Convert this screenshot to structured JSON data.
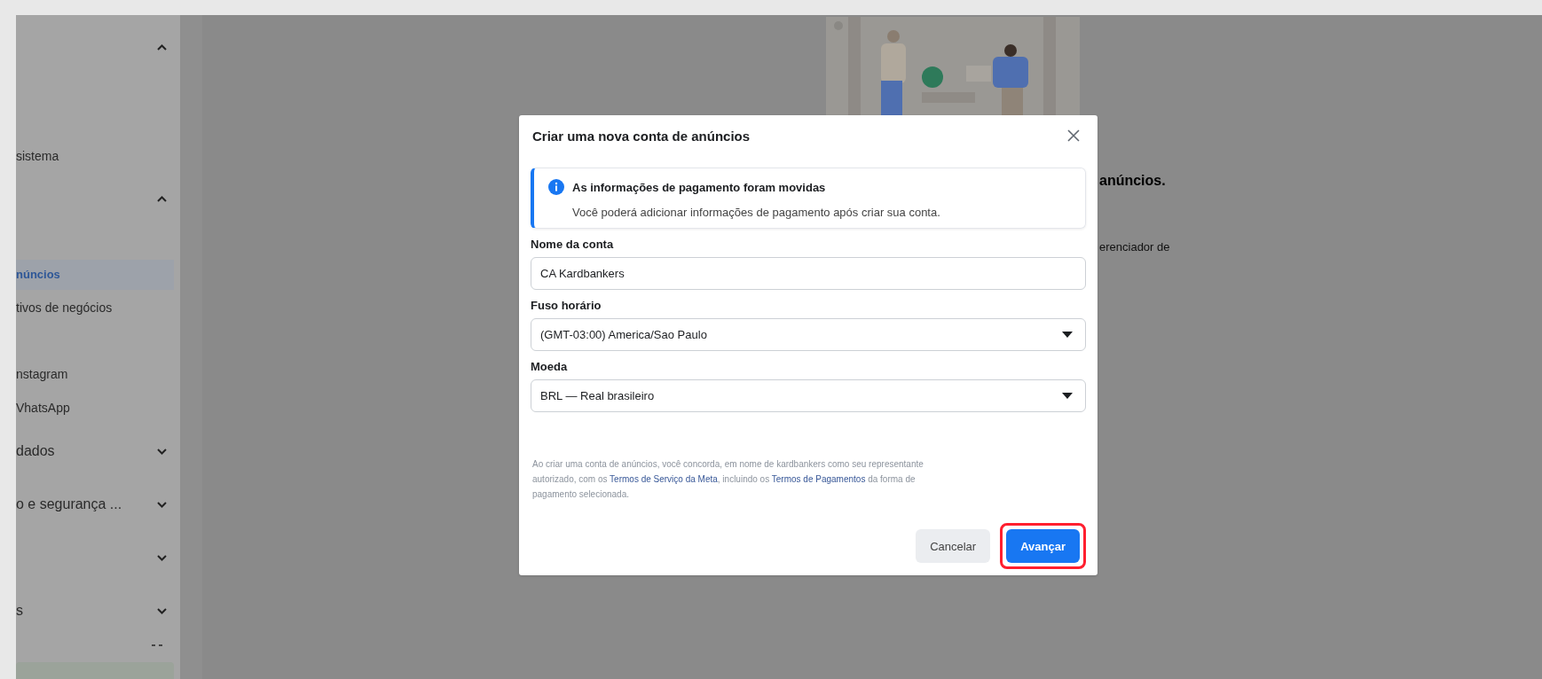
{
  "sidebar": {
    "items": [
      {
        "kind": "group",
        "expanded": true
      },
      {
        "kind": "item",
        "label": "sistema",
        "selected": false
      },
      {
        "kind": "group",
        "expanded": true
      },
      {
        "kind": "item",
        "label": "núncios",
        "selected": true
      },
      {
        "kind": "item",
        "label": "tivos de negócios",
        "selected": false
      },
      {
        "kind": "item",
        "label": "nstagram",
        "selected": false
      },
      {
        "kind": "item",
        "label": "VhatsApp",
        "selected": false
      },
      {
        "kind": "group",
        "label": "dados",
        "expanded": false
      },
      {
        "kind": "group",
        "label": "o e segurança ...",
        "expanded": false
      },
      {
        "kind": "group",
        "expanded": false
      },
      {
        "kind": "group",
        "label": "s",
        "expanded": false
      }
    ]
  },
  "background": {
    "heading": "anúncios.",
    "text": "erenciador de"
  },
  "dialog": {
    "title": "Criar uma nova conta de anúncios",
    "notice": {
      "title": "As informações de pagamento foram movidas",
      "text": "Você poderá adicionar informações de pagamento após criar sua conta."
    },
    "fields": [
      {
        "kind": "text",
        "label": "Nome da conta",
        "value": "CA Kardbankers"
      },
      {
        "kind": "select",
        "label": "Fuso horário",
        "value": "(GMT-03:00) America/Sao Paulo"
      },
      {
        "kind": "select",
        "label": "Moeda",
        "value": "BRL — Real brasileiro"
      }
    ],
    "legal": [
      {
        "kind": "text",
        "text": "Ao criar uma conta de anúncios, você concorda, em nome de kardbankers como seu representante autorizado, com os "
      },
      {
        "kind": "link",
        "text": "Termos de Serviço da Meta"
      },
      {
        "kind": "text",
        "text": ", incluindo os "
      },
      {
        "kind": "link",
        "text": "Termos de Pagamentos"
      },
      {
        "kind": "text",
        "text": " da forma de pagamento selecionada."
      }
    ],
    "buttons": [
      {
        "kind": "secondary",
        "label": "Cancelar",
        "highlighted": false
      },
      {
        "kind": "primary",
        "label": "Avançar",
        "highlighted": true
      }
    ]
  }
}
